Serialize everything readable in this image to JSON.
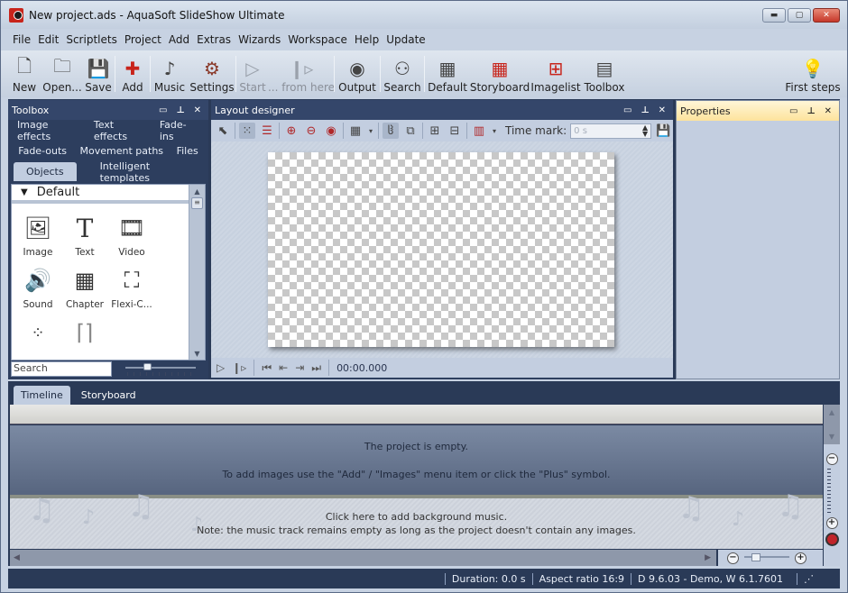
{
  "window": {
    "title": "New project.ads - AquaSoft SlideShow Ultimate",
    "controls": [
      "minimize",
      "maximize",
      "close"
    ]
  },
  "menu": [
    "File",
    "Edit",
    "Scriptlets",
    "Project",
    "Add",
    "Extras",
    "Wizards",
    "Workspace",
    "Help",
    "Update"
  ],
  "toolbar": {
    "new": "New",
    "open": "Open...",
    "save": "Save",
    "add": "Add",
    "music": "Music",
    "settings": "Settings",
    "start": "Start",
    "from_here": "... from here",
    "output": "Output",
    "search": "Search",
    "default": "Default",
    "storyboard": "Storyboard",
    "imagelist": "Imagelist",
    "toolbox": "Toolbox",
    "first_steps": "First steps"
  },
  "toolbox": {
    "title": "Toolbox",
    "tabs_row1": [
      "Image effects",
      "Text effects",
      "Fade-ins"
    ],
    "tabs_row2": [
      "Fade-outs",
      "Movement paths",
      "Files"
    ],
    "tabs_row3": [
      "Objects",
      "Intelligent templates"
    ],
    "active_tab": "Objects",
    "group": "Default",
    "objects": [
      {
        "name": "Image",
        "icon": "image-icon"
      },
      {
        "name": "Text",
        "icon": "text-icon"
      },
      {
        "name": "Video",
        "icon": "video-icon"
      },
      {
        "name": "Sound",
        "icon": "sound-icon"
      },
      {
        "name": "Chapter",
        "icon": "chapter-icon"
      },
      {
        "name": "Flexi-C...",
        "icon": "flexi-collage-icon"
      }
    ],
    "search_placeholder": "Search"
  },
  "designer": {
    "title": "Layout designer",
    "time_mark_label": "Time mark:",
    "time_mark_value": "0 s",
    "time": "00:00.000"
  },
  "properties": {
    "title": "Properties"
  },
  "bottom": {
    "tabs": [
      "Timeline",
      "Storyboard"
    ],
    "active_tab": "Timeline",
    "empty_msg": "The project is empty.",
    "empty_hint": "To add images use the \"Add\" / \"Images\" menu item or click the \"Plus\" symbol.",
    "music_msg": "Click here to add background music.",
    "music_note": "Note: the music track remains empty as long as the project doesn't contain any images."
  },
  "status": {
    "duration": "Duration: 0.0 s",
    "aspect": "Aspect ratio 16:9",
    "version": "D 9.6.03 - Demo, W 6.1.7601"
  },
  "colors": {
    "accent_red": "#c8241b",
    "dock_bg": "#2a3a57",
    "props_header": "#fde39c"
  }
}
